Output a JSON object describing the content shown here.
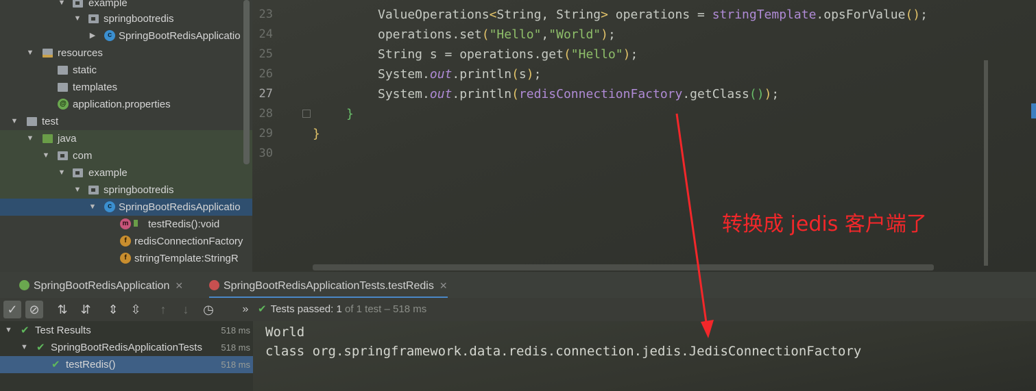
{
  "project_tree": {
    "items": [
      {
        "label": "example",
        "icon": "package-icon"
      },
      {
        "label": "springbootredis",
        "icon": "package-icon"
      },
      {
        "label": "SpringBootRedisApplicatio",
        "icon": "class-icon"
      },
      {
        "label": "resources",
        "icon": "resources-folder-icon"
      },
      {
        "label": "static",
        "icon": "folder-icon"
      },
      {
        "label": "templates",
        "icon": "folder-icon"
      },
      {
        "label": "application.properties",
        "icon": "properties-file-icon"
      },
      {
        "label": "test",
        "icon": "folder-icon"
      },
      {
        "label": "java",
        "icon": "test-source-folder-icon"
      },
      {
        "label": "com",
        "icon": "package-icon"
      },
      {
        "label": "example",
        "icon": "package-icon"
      },
      {
        "label": "springbootredis",
        "icon": "package-icon"
      },
      {
        "label": "SpringBootRedisApplicatio",
        "icon": "class-icon",
        "selected": true
      },
      {
        "label": "testRedis():void",
        "icon": "method-icon"
      },
      {
        "label": "redisConnectionFactory",
        "icon": "field-icon"
      },
      {
        "label": "stringTemplate:StringR",
        "icon": "field-icon"
      }
    ]
  },
  "editor": {
    "line_numbers": [
      "23",
      "24",
      "25",
      "26",
      "27",
      "28",
      "29",
      "30"
    ],
    "active_line": "27",
    "lines": {
      "l23": {
        "a": "ValueOperations",
        "b": "<",
        "c": "String, String",
        "d": ">",
        "e": " operations = ",
        "f": "stringTemplate",
        "g": ".opsForValue",
        "h": "()",
        "i": ";"
      },
      "l24": {
        "a": "operations.set",
        "b": "(",
        "c": "\"Hello\"",
        "d": ",",
        "e": "\"World\"",
        "f": ")",
        "g": ";"
      },
      "l25": {
        "a": "String s = operations.get",
        "b": "(",
        "c": "\"Hello\"",
        "d": ")",
        "e": ";"
      },
      "l26": {
        "a": "System.",
        "b": "out",
        "c": ".println",
        "d": "(",
        "e": "s",
        "f": ")",
        "g": ";"
      },
      "l27": {
        "a": "System.",
        "b": "out",
        "c": ".println",
        "d": "(",
        "e": "redisConnectionFactory",
        "f": ".getClass",
        "g": "()",
        "h": ")",
        "i": ";"
      },
      "l28": {
        "a": "}"
      },
      "l29": {
        "a": "}"
      }
    }
  },
  "annotation": {
    "text": "转换成 jedis 客户端了",
    "color": "#f2272a"
  },
  "run_tabs": [
    {
      "label": "SpringBootRedisApplication",
      "icon": "spring-app-icon"
    },
    {
      "label": "SpringBootRedisApplicationTests.testRedis",
      "icon": "junit-test-icon",
      "active": true
    }
  ],
  "toolbar": {
    "status_passed": "Tests passed:",
    "status_count": "1",
    "status_detail": "of 1 test – 518 ms",
    "overflow": "»"
  },
  "results": {
    "rows": [
      {
        "label": "Test Results",
        "time": "518 ms"
      },
      {
        "label": "SpringBootRedisApplicationTests",
        "time": "518 ms"
      },
      {
        "label": "testRedis()",
        "time": "518 ms",
        "selected": true
      }
    ]
  },
  "console": {
    "lines": [
      "World",
      "class org.springframework.data.redis.connection.jedis.JedisConnectionFactory"
    ]
  },
  "colors": {
    "accent": "#4a88c7",
    "success": "#5fb85c",
    "annotation": "#f2272a"
  }
}
